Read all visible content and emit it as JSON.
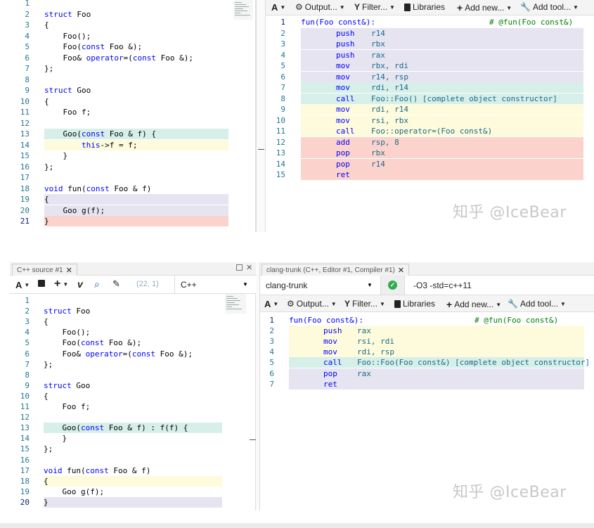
{
  "top": {
    "toolbar": {
      "font_btn": "A",
      "output_btn": "Output...",
      "filter_btn": "Filter...",
      "libraries_btn": "Libraries",
      "add_new_btn": "Add new...",
      "add_tool_btn": "Add tool..."
    },
    "source_lines": [
      {
        "n": "1",
        "text": ""
      },
      {
        "n": "2",
        "text": "struct Foo"
      },
      {
        "n": "3",
        "text": "{"
      },
      {
        "n": "4",
        "text": "    Foo();"
      },
      {
        "n": "5",
        "text": "    Foo(const Foo &);"
      },
      {
        "n": "6",
        "text": "    Foo& operator=(const Foo &);"
      },
      {
        "n": "7",
        "text": "};"
      },
      {
        "n": "8",
        "text": ""
      },
      {
        "n": "9",
        "text": "struct Goo"
      },
      {
        "n": "10",
        "text": "{"
      },
      {
        "n": "11",
        "text": "    Foo f;"
      },
      {
        "n": "12",
        "text": ""
      },
      {
        "n": "13",
        "text": "    Goo(const Foo & f) {"
      },
      {
        "n": "14",
        "text": "        this->f = f;"
      },
      {
        "n": "15",
        "text": "    }"
      },
      {
        "n": "16",
        "text": "};"
      },
      {
        "n": "17",
        "text": ""
      },
      {
        "n": "18",
        "text": "void fun(const Foo & f)"
      },
      {
        "n": "19",
        "text": "{"
      },
      {
        "n": "20",
        "text": "    Goo g(f);"
      },
      {
        "n": "21",
        "text": "}"
      }
    ],
    "asm_lines": [
      {
        "n": "1",
        "label": "fun(Foo const&):",
        "op": "",
        "args": "",
        "comment": "# @fun(Foo const&)"
      },
      {
        "n": "2",
        "label": "",
        "op": "push",
        "args": "r14",
        "comment": ""
      },
      {
        "n": "3",
        "label": "",
        "op": "push",
        "args": "rbx",
        "comment": ""
      },
      {
        "n": "4",
        "label": "",
        "op": "push",
        "args": "rax",
        "comment": ""
      },
      {
        "n": "5",
        "label": "",
        "op": "mov",
        "args": "rbx, rdi",
        "comment": ""
      },
      {
        "n": "6",
        "label": "",
        "op": "mov",
        "args": "r14, rsp",
        "comment": ""
      },
      {
        "n": "7",
        "label": "",
        "op": "mov",
        "args": "rdi, r14",
        "comment": ""
      },
      {
        "n": "8",
        "label": "",
        "op": "call",
        "args": "Foo::Foo() [complete object constructor]",
        "comment": ""
      },
      {
        "n": "9",
        "label": "",
        "op": "mov",
        "args": "rdi, r14",
        "comment": ""
      },
      {
        "n": "10",
        "label": "",
        "op": "mov",
        "args": "rsi, rbx",
        "comment": ""
      },
      {
        "n": "11",
        "label": "",
        "op": "call",
        "args": "Foo::operator=(Foo const&)",
        "comment": ""
      },
      {
        "n": "12",
        "label": "",
        "op": "add",
        "args": "rsp, 8",
        "comment": ""
      },
      {
        "n": "13",
        "label": "",
        "op": "pop",
        "args": "rbx",
        "comment": ""
      },
      {
        "n": "14",
        "label": "",
        "op": "pop",
        "args": "r14",
        "comment": ""
      },
      {
        "n": "15",
        "label": "",
        "op": "ret",
        "args": "",
        "comment": ""
      }
    ],
    "watermark": "知乎 @IceBear"
  },
  "bottom": {
    "source_tab": "C++ source #1",
    "compiler_tab": "clang-trunk (C++, Editor #1, Compiler #1)",
    "cursor_pos": "(22, 1)",
    "language": "C++",
    "compiler": "clang-trunk",
    "flags": "-O3 -std=c++11",
    "toolbar": {
      "font_btn": "A",
      "output_btn": "Output...",
      "filter_btn": "Filter...",
      "libraries_btn": "Libraries",
      "add_new_btn": "Add new...",
      "add_tool_btn": "Add tool..."
    },
    "source_lines": [
      {
        "n": "1",
        "text": ""
      },
      {
        "n": "2",
        "text": "struct Foo"
      },
      {
        "n": "3",
        "text": "{"
      },
      {
        "n": "4",
        "text": "    Foo();"
      },
      {
        "n": "5",
        "text": "    Foo(const Foo &);"
      },
      {
        "n": "6",
        "text": "    Foo& operator=(const Foo &);"
      },
      {
        "n": "7",
        "text": "};"
      },
      {
        "n": "8",
        "text": ""
      },
      {
        "n": "9",
        "text": "struct Goo"
      },
      {
        "n": "10",
        "text": "{"
      },
      {
        "n": "11",
        "text": "    Foo f;"
      },
      {
        "n": "12",
        "text": ""
      },
      {
        "n": "13",
        "text": "    Goo(const Foo & f) : f(f) {"
      },
      {
        "n": "14",
        "text": "    }"
      },
      {
        "n": "15",
        "text": "};"
      },
      {
        "n": "16",
        "text": ""
      },
      {
        "n": "17",
        "text": "void fun(const Foo & f)"
      },
      {
        "n": "18",
        "text": "{"
      },
      {
        "n": "19",
        "text": "    Goo g(f);"
      },
      {
        "n": "20",
        "text": "}"
      }
    ],
    "asm_lines": [
      {
        "n": "1",
        "label": "fun(Foo const&):",
        "op": "",
        "args": "",
        "comment": "# @fun(Foo const&)"
      },
      {
        "n": "2",
        "label": "",
        "op": "push",
        "args": "rax",
        "comment": ""
      },
      {
        "n": "3",
        "label": "",
        "op": "mov",
        "args": "rsi, rdi",
        "comment": ""
      },
      {
        "n": "4",
        "label": "",
        "op": "mov",
        "args": "rdi, rsp",
        "comment": ""
      },
      {
        "n": "5",
        "label": "",
        "op": "call",
        "args": "Foo::Foo(Foo const&) [complete object constructor]",
        "comment": ""
      },
      {
        "n": "6",
        "label": "",
        "op": "pop",
        "args": "rax",
        "comment": ""
      },
      {
        "n": "7",
        "label": "",
        "op": "ret",
        "args": "",
        "comment": ""
      }
    ],
    "watermark": "知乎 @IceBear"
  },
  "colors": {
    "lavender": "#e6e4f0",
    "teal": "#d6efe9",
    "yellow": "#fdfbdc",
    "pink": "#fcd3cc",
    "gutter": "#237893",
    "keyword": "#0000ff",
    "compile_ok": "#2fae4e"
  },
  "icons": [
    "caret-down-icon",
    "gear-icon",
    "filter-icon",
    "book-icon",
    "plus-icon",
    "wrench-icon",
    "save-icon",
    "vim-icon",
    "search-icon",
    "pin-icon",
    "close-icon",
    "maximize-icon",
    "check-circle-icon"
  ]
}
